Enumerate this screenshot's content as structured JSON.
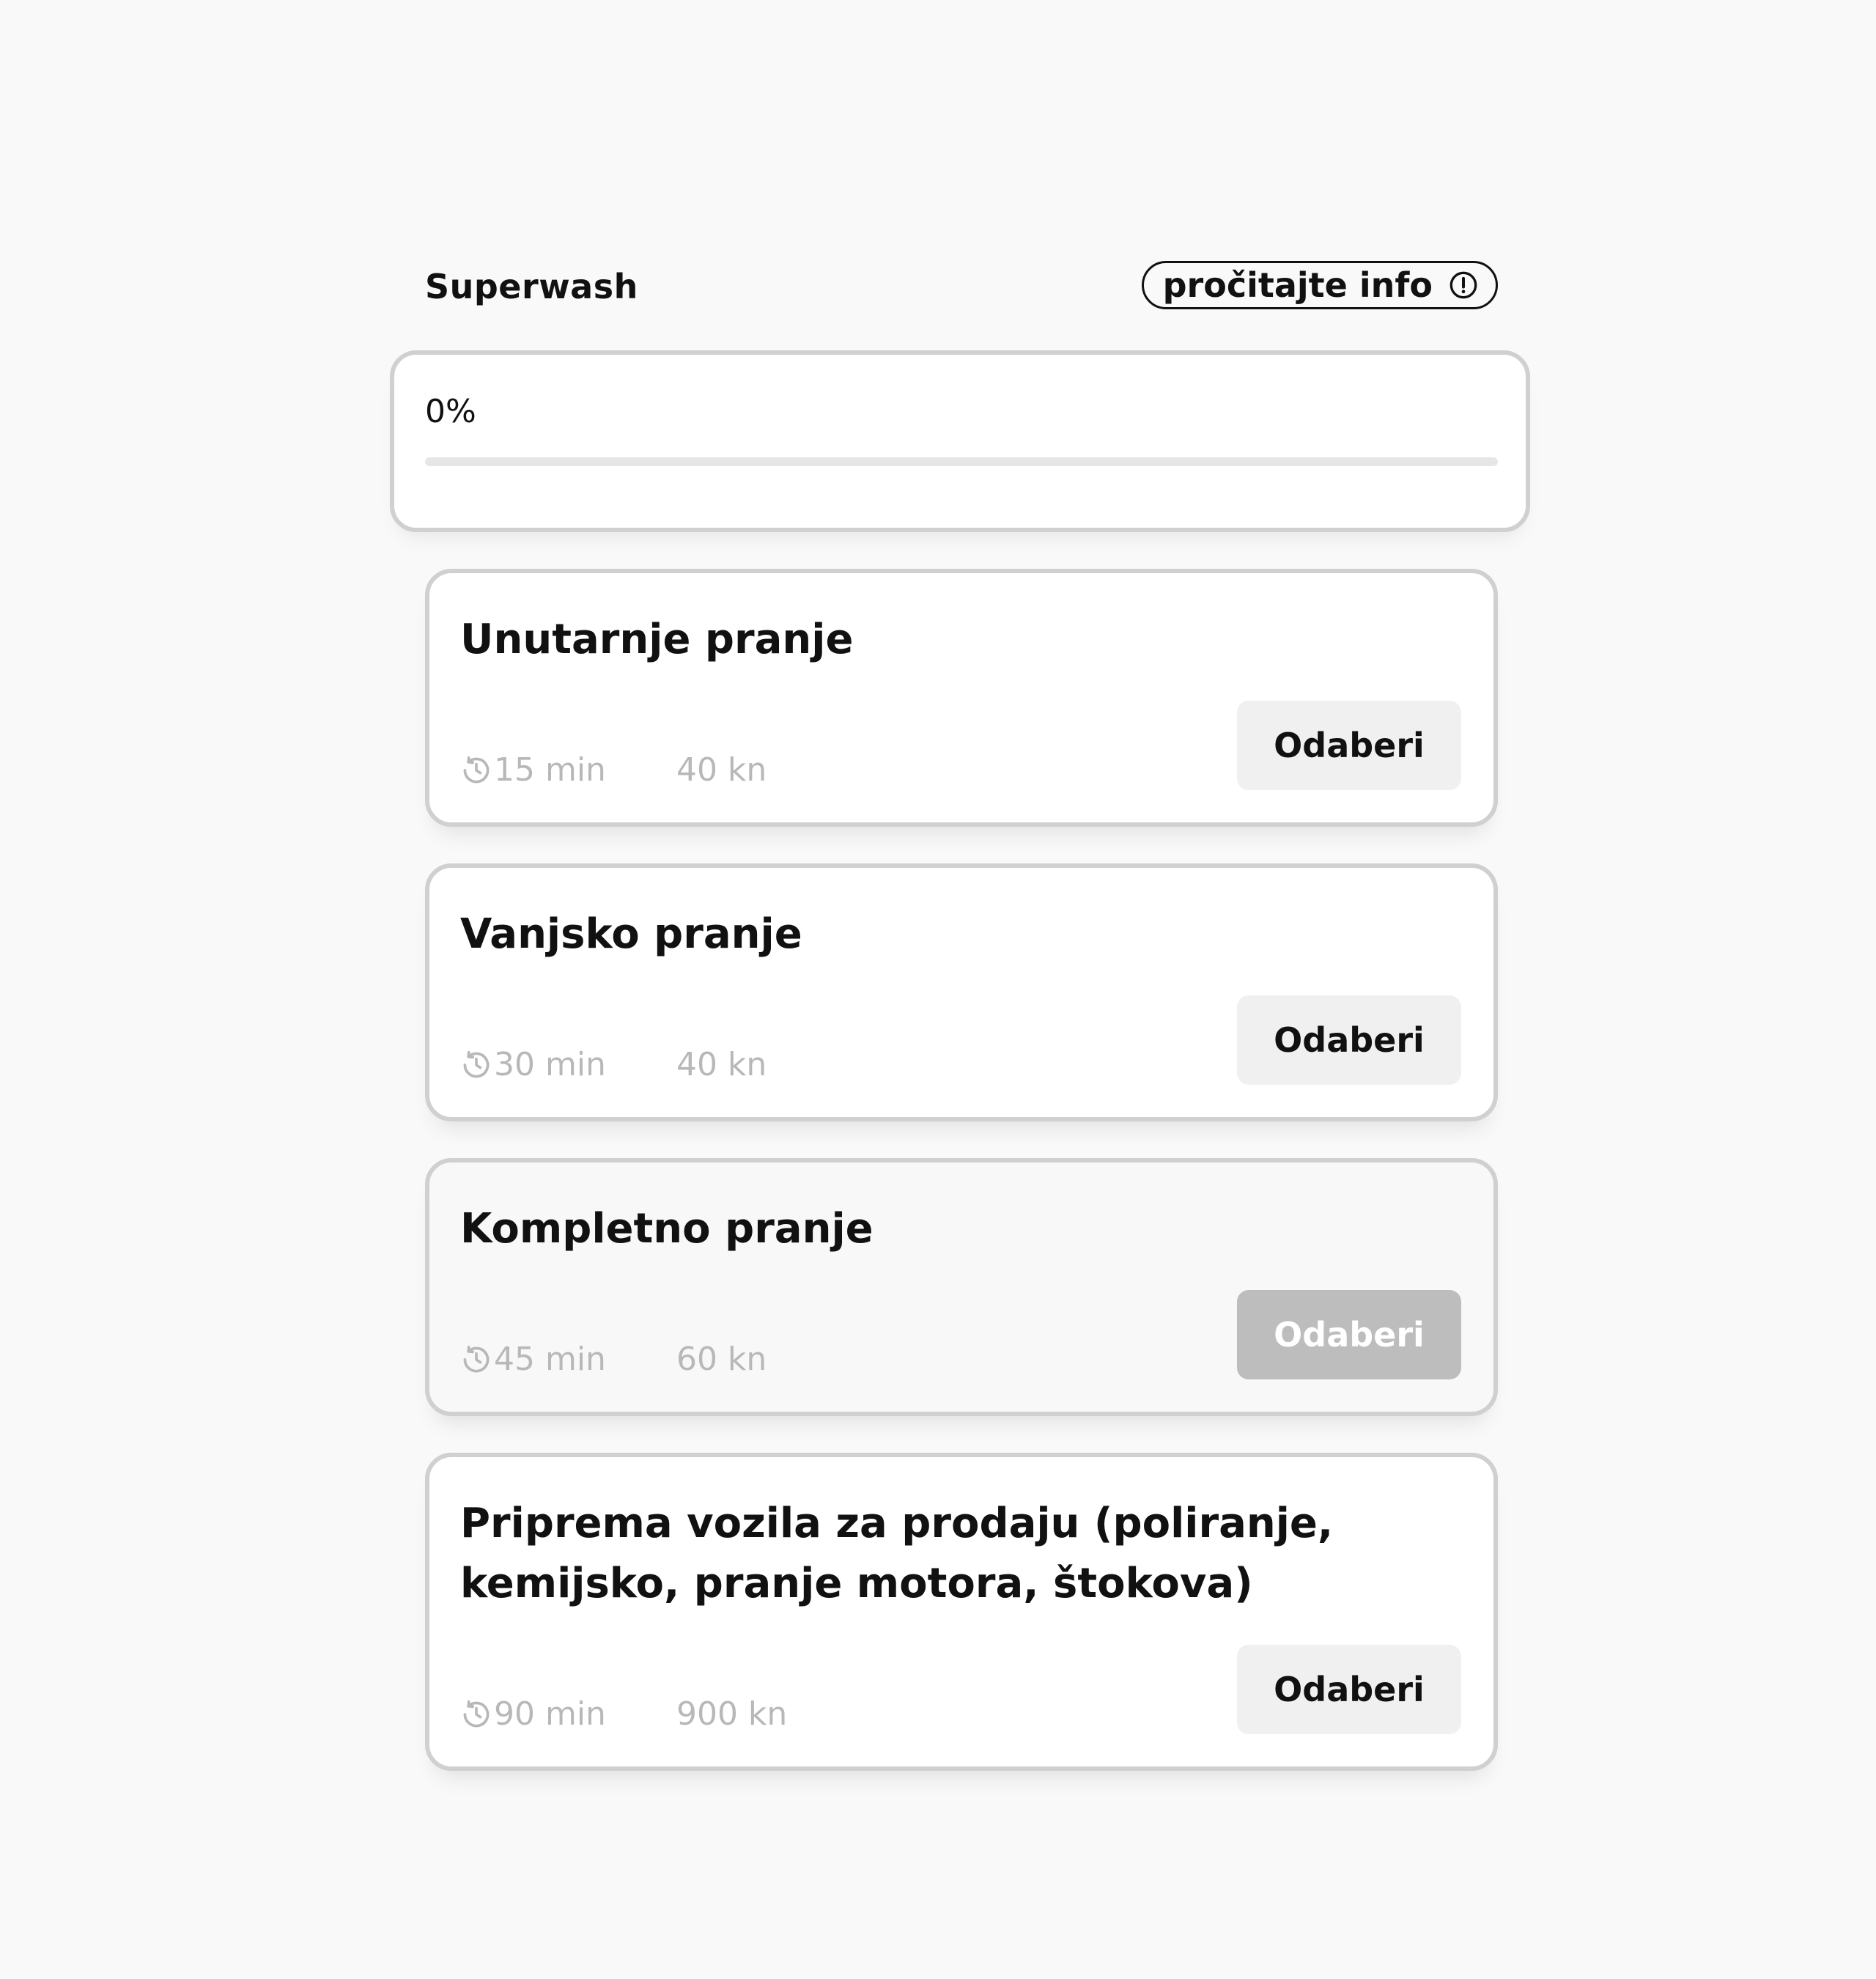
{
  "header": {
    "title": "Superwash",
    "info_label": "pročitajte info",
    "info_icon": "exclamation-circle-icon"
  },
  "progress": {
    "label": "0%",
    "value": 0
  },
  "services": [
    {
      "title": "Unutarnje pranje",
      "duration": "15 min",
      "price": "40 kn",
      "button_label": "Odaberi",
      "selected": false
    },
    {
      "title": "Vanjsko pranje",
      "duration": "30 min",
      "price": "40 kn",
      "button_label": "Odaberi",
      "selected": false
    },
    {
      "title": "Kompletno pranje",
      "duration": "45 min",
      "price": "60 kn",
      "button_label": "Odaberi",
      "selected": true
    },
    {
      "title": "Priprema vozila za prodaju (poliranje, kemijsko, pranje motora, štokova)",
      "duration": "90 min",
      "price": "900 kn",
      "button_label": "Odaberi",
      "selected": false
    }
  ],
  "icons": {
    "duration": "clock-history-icon"
  },
  "colors": {
    "background": "#f9f9f9",
    "card_border": "#d0d0d0",
    "muted_text": "#b8b8b8",
    "button_bg": "#f0f0f0",
    "button_selected_bg": "#bdbdbd",
    "text": "#111111"
  }
}
